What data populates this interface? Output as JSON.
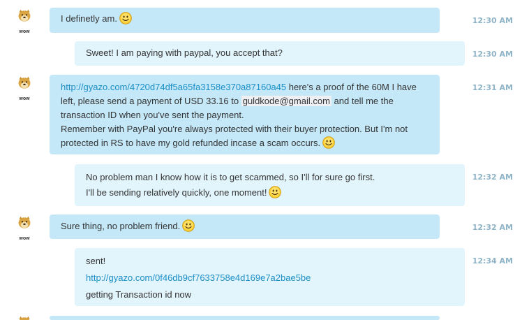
{
  "chat": {
    "messages": [
      {
        "sender": "them",
        "avatar_caption": "wow",
        "time": "12:30 AM",
        "lines": [
          {
            "text": "I definetly am."
          }
        ]
      },
      {
        "sender": "me",
        "time": "12:30 AM",
        "lines": [
          {
            "text": "Sweet! I am paying with paypal, you accept that?"
          }
        ]
      },
      {
        "sender": "them",
        "avatar_caption": "wow",
        "time": "12:31 AM",
        "link": "http://gyazo.com/4720d74df5a65fa3158e370a87160a45",
        "text_a": " here's a proof of the 60M I have left, please send a payment of USD 33.16 to ",
        "email": "guldkode@gmail.com",
        "text_b": " and tell me the transaction ID when you've sent the payment.",
        "text_c": "Remember with PayPal you're always protected with their buyer protection. But I'm not protected in RS to have my gold refunded incase a scam occurs."
      },
      {
        "sender": "me",
        "time": "12:32 AM",
        "line1": "No problem man I know how it is to get scammed, so I'll for sure go first.",
        "line2": "I'll be sending relatively quickly, one moment!"
      },
      {
        "sender": "them",
        "avatar_caption": "wow",
        "time": "12:32 AM",
        "text": "Sure thing, no problem friend."
      },
      {
        "sender": "me",
        "time": "12:34 AM",
        "line1": "sent!",
        "link": "http://gyazo.com/0f46db9cf7633758e4d169e7a2bae5be",
        "line3": "getting Transaction id now"
      }
    ]
  },
  "colors": {
    "their_bubble": "#c5e8f8",
    "my_bubble": "#e2f4fc",
    "link": "#1a8fc7",
    "timestamp": "#8fb4c8"
  },
  "icons": {
    "avatar": "doge-avatar-icon",
    "emoji": "smiley-icon"
  }
}
